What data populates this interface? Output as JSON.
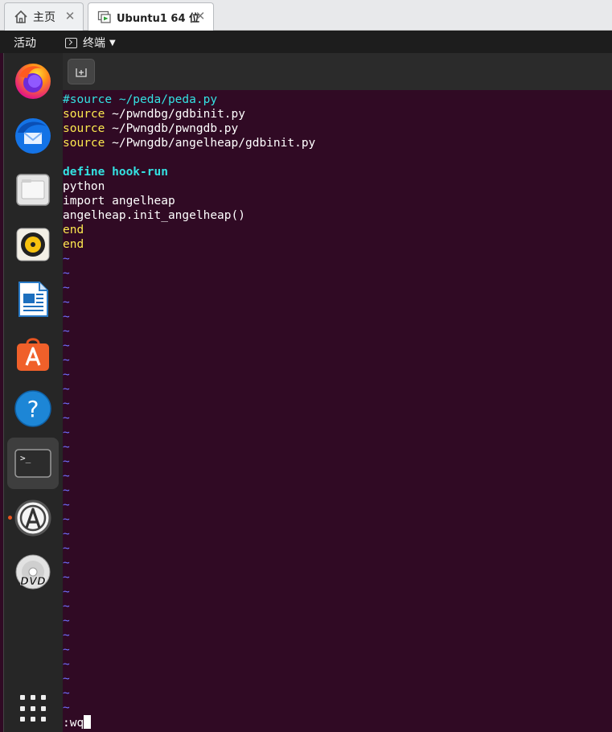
{
  "host_tabs": [
    {
      "label": "主页",
      "icon": "home-icon"
    },
    {
      "label": "Ubuntu1 64 位",
      "icon": "vm-icon"
    }
  ],
  "topbar": {
    "activities": "活动",
    "app_name": "终端"
  },
  "dock": {
    "items": [
      {
        "name": "firefox",
        "icon": "firefox-icon"
      },
      {
        "name": "thunderbird",
        "icon": "thunderbird-icon"
      },
      {
        "name": "files",
        "icon": "files-icon"
      },
      {
        "name": "rhythmbox",
        "icon": "rhythmbox-icon"
      },
      {
        "name": "libreoffice-writer",
        "icon": "writer-icon"
      },
      {
        "name": "ubuntu-software",
        "icon": "software-icon"
      },
      {
        "name": "help",
        "icon": "help-icon"
      },
      {
        "name": "terminal",
        "icon": "terminal-icon",
        "active": true
      },
      {
        "name": "software-updater",
        "icon": "updater-icon"
      },
      {
        "name": "dvd",
        "icon": "dvd-icon"
      }
    ],
    "help_glyph": "?",
    "terminal_glyph": ">_",
    "dvd_text": "DVD"
  },
  "editor": {
    "lines": [
      {
        "segments": [
          {
            "text": "#source ~/peda/peda.py",
            "style": "comment"
          }
        ]
      },
      {
        "segments": [
          {
            "text": "source",
            "style": "kw"
          },
          {
            "text": " ~/pwndbg/gdbinit.py",
            "style": "plain"
          }
        ]
      },
      {
        "segments": [
          {
            "text": "source",
            "style": "kw"
          },
          {
            "text": " ~/Pwngdb/pwngdb.py",
            "style": "plain"
          }
        ]
      },
      {
        "segments": [
          {
            "text": "source",
            "style": "kw"
          },
          {
            "text": " ~/Pwngdb/angelheap/gdbinit.py",
            "style": "plain"
          }
        ]
      },
      {
        "segments": []
      },
      {
        "segments": [
          {
            "text": "define hook-run",
            "style": "def"
          }
        ]
      },
      {
        "segments": [
          {
            "text": "python",
            "style": "plain"
          }
        ]
      },
      {
        "segments": [
          {
            "text": "import angelheap",
            "style": "plain"
          }
        ]
      },
      {
        "segments": [
          {
            "text": "angelheap.init_angelheap()",
            "style": "plain"
          }
        ]
      },
      {
        "segments": [
          {
            "text": "end",
            "style": "kw"
          }
        ]
      },
      {
        "segments": [
          {
            "text": "end",
            "style": "kw"
          }
        ]
      }
    ],
    "tilde": "~",
    "tilde_count": 32,
    "command_line": ":wq"
  },
  "colors": {
    "terminal_bg": "#300a24",
    "keyword": "#fce94f",
    "comment": "#34e2e2",
    "tilde": "#6f6fff",
    "accent_dot": "#e95420"
  }
}
